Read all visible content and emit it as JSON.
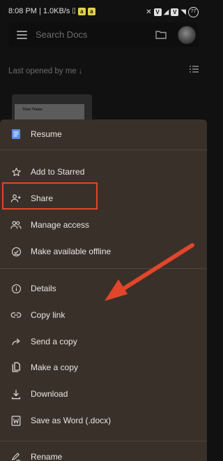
{
  "status_bar": {
    "time": "8:08 PM",
    "speed": "1.0KB/s",
    "battery": "77",
    "icons": [
      "vibrate-icon",
      "app-notification-icon",
      "vowifi-icon",
      "signal-icon",
      "wifi-icon",
      "battery-icon"
    ]
  },
  "search": {
    "placeholder": "Search Docs",
    "menu_icon": "hamburger-icon",
    "folder_icon": "folder-icon"
  },
  "list": {
    "sort_label": "Last opened by me",
    "sort_arrow": "↓",
    "view_icon": "list-view-icon"
  },
  "doc_thumbnail": {
    "text": "Your Name"
  },
  "sheet": {
    "title_item": {
      "label": "Resume",
      "icon": "docs-icon",
      "accent": "#5b8def"
    },
    "items": [
      {
        "label": "Add to Starred",
        "icon": "star-icon"
      },
      {
        "label": "Share",
        "icon": "person-add-icon"
      },
      {
        "label": "Manage access",
        "icon": "people-icon"
      },
      {
        "label": "Make available offline",
        "icon": "offline-check-icon"
      },
      {
        "label": "Details",
        "icon": "info-icon"
      },
      {
        "label": "Copy link",
        "icon": "link-icon"
      },
      {
        "label": "Send a copy",
        "icon": "forward-arrow-icon"
      },
      {
        "label": "Make a copy",
        "icon": "copy-icon"
      },
      {
        "label": "Download",
        "icon": "download-icon"
      },
      {
        "label": "Save as Word (.docx)",
        "icon": "word-doc-icon"
      },
      {
        "label": "Rename",
        "icon": "rename-icon"
      }
    ]
  },
  "annotation": {
    "color": "#e1462a",
    "target": "Copy link"
  }
}
